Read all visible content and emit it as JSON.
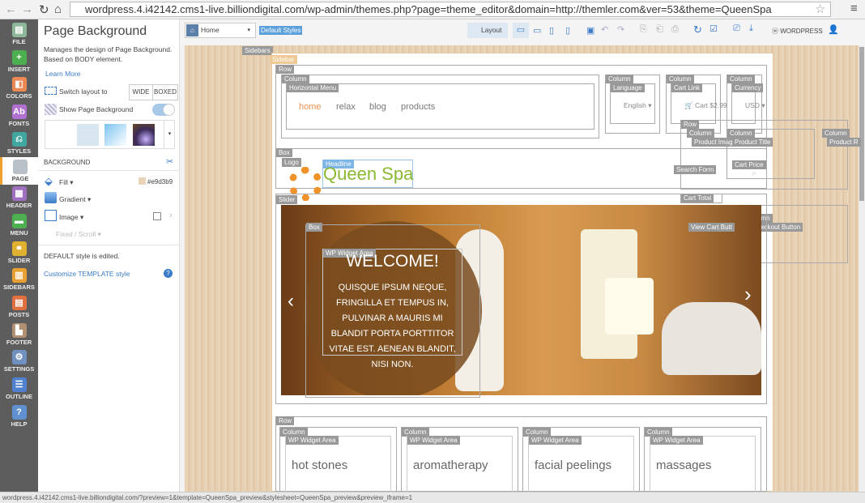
{
  "browser": {
    "url": "wordpress.4.i42142.cms1-live.billiondigital.com/wp-admin/themes.php?page=theme_editor&domain=http://themler.com&ver=53&theme=QueenSpa",
    "status_url": "wordpress.4.i42142.cms1-live.billiondigital.com/?preview=1&template=QueenSpa_preview&stylesheet=QueenSpa_preview&preview_iframe=1"
  },
  "rail": [
    {
      "label": "FILE",
      "color": "#8fb89a"
    },
    {
      "label": "INSERT",
      "color": "#4caf50"
    },
    {
      "label": "COLORS",
      "color": "#e85"
    },
    {
      "label": "FONTS",
      "color": "#b070d0"
    },
    {
      "label": "STYLES",
      "color": "#40a8a0"
    },
    {
      "label": "PAGE",
      "color": "#b8c0c8"
    },
    {
      "label": "HEADER",
      "color": "#a070c0"
    },
    {
      "label": "MENU",
      "color": "#4caf50"
    },
    {
      "label": "SLIDER",
      "color": "#e0b030"
    },
    {
      "label": "SIDEBARS",
      "color": "#e8a030"
    },
    {
      "label": "POSTS",
      "color": "#e07040"
    },
    {
      "label": "FOOTER",
      "color": "#b09070"
    },
    {
      "label": "SETTINGS",
      "color": "#7090c0"
    },
    {
      "label": "OUTLINE",
      "color": "#5080d0"
    },
    {
      "label": "HELP",
      "color": "#6090d0"
    }
  ],
  "panel": {
    "title": "Page Background",
    "desc": "Manages the design of Page Background. Based on BODY element.",
    "learn_more": "Learn More",
    "switch_layout": "Switch layout to",
    "wide": "WIDE",
    "boxed": "BOXED",
    "show_bg": "Show Page Background",
    "show_bg_on": true,
    "section": "BACKGROUND",
    "fill": "Fill",
    "fill_color": "#e9d3b9",
    "gradient": "Gradient",
    "image": "Image",
    "fixed": "Fixed / Scroll",
    "edited": "DEFAULT style is edited.",
    "customize": "Customize TEMPLATE style"
  },
  "toolbar": {
    "page": "Home",
    "styles": "Default Styles",
    "layout": "Layout",
    "wordpress": "WORDPRESS"
  },
  "site": {
    "labels": {
      "sidebars": "Sidebars",
      "sidebar": "Sidebar",
      "row": "Row",
      "column": "Column",
      "hmenu": "Horizontal Menu",
      "language": "Language",
      "cart_link": "Cart Link",
      "currency": "Currency",
      "product_image": "Product Imag",
      "product_title": "Product Title",
      "product_r": "Product R",
      "cart_price": "Cart Price",
      "search_form": "Search Form",
      "cart_total": "Cart Total",
      "view_cart": "View Cart Butt",
      "checkout": "Checkout Button",
      "box": "Box",
      "logo": "Logo",
      "headline": "Headline",
      "slider": "Slider",
      "wp_widget": "WP Widget Area"
    },
    "menu": [
      "home",
      "relax",
      "blog",
      "products"
    ],
    "language": "English",
    "cart": "Cart $2.99",
    "currency": "USD",
    "headline": "Queen Spa",
    "welcome": "WELCOME!",
    "welcome_text": "QUISQUE IPSUM NEQUE, FRINGILLA ET TEMPUS IN, PULVINAR A MAURIS MI BLANDIT PORTA PORTTITOR VITAE EST. AENEAN BLANDIT, NISI NON.",
    "cards": [
      "hot stones",
      "aromatherapy",
      "facial peelings",
      "massages"
    ]
  }
}
